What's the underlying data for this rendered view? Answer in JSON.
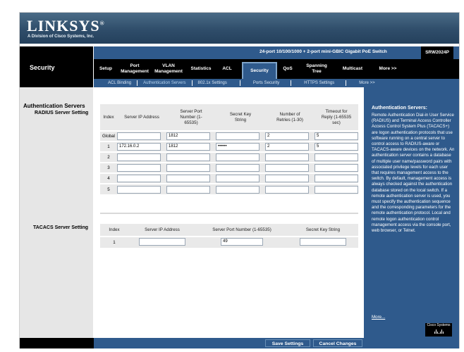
{
  "brand": {
    "logo": "LINKSYS",
    "tagline": "A Division of Cisco Systems, Inc."
  },
  "header": {
    "section": "Security",
    "model_desc": "24-port 10/100/1000 + 2-port mini-GBIC Gigabit PoE Switch",
    "model_num": "SRW2024P"
  },
  "tabs": [
    {
      "label": "Setup"
    },
    {
      "label": "Port Management"
    },
    {
      "label": "VLAN Management"
    },
    {
      "label": "Statistics"
    },
    {
      "label": "ACL"
    },
    {
      "label": "Security"
    },
    {
      "label": "QoS"
    },
    {
      "label": "Spanning Tree"
    },
    {
      "label": "Multicast"
    },
    {
      "label": "More >>"
    }
  ],
  "subtabs": [
    {
      "label": "ACL Binding"
    },
    {
      "label": "Authentication Servers"
    },
    {
      "label": "802.1x Settings"
    },
    {
      "label": "Ports Security"
    },
    {
      "label": "HTTPS Settings"
    },
    {
      "label": "More >>"
    }
  ],
  "sidebar": {
    "heading": "Authentication Servers",
    "radius_label": "RADIUS Server Setting",
    "tacacs_label": "TACACS Server Setting"
  },
  "radius": {
    "headers": {
      "index": "Index",
      "ip": "Server IP Address",
      "port": "Server Port Number (1-65535)",
      "key": "Secret Key String",
      "retries": "Number of Retries (1-30)",
      "timeout": "Timeout for Reply (1-65535 sec)"
    },
    "rows": [
      {
        "index": "Global",
        "ip": "",
        "port": "1812",
        "key": "",
        "retries": "2",
        "timeout": "5"
      },
      {
        "index": "1",
        "ip": "172.16.0.2",
        "port": "1812",
        "key": "••••••",
        "retries": "2",
        "timeout": "5"
      },
      {
        "index": "2",
        "ip": "",
        "port": "",
        "key": "",
        "retries": "",
        "timeout": ""
      },
      {
        "index": "3",
        "ip": "",
        "port": "",
        "key": "",
        "retries": "",
        "timeout": ""
      },
      {
        "index": "4",
        "ip": "",
        "port": "",
        "key": "",
        "retries": "",
        "timeout": ""
      },
      {
        "index": "5",
        "ip": "",
        "port": "",
        "key": "",
        "retries": "",
        "timeout": ""
      }
    ]
  },
  "tacacs": {
    "headers": {
      "index": "Index",
      "ip": "Server IP Address",
      "port": "Server Port Number (1-65535)",
      "key": "Secret Key String"
    },
    "rows": [
      {
        "index": "1",
        "ip": "",
        "port": "49",
        "key": ""
      }
    ]
  },
  "help": {
    "title": "Authentication Servers:",
    "body": "Remote Authentication Dial-in User Service (RADIUS) and Terminal Access Controller Access Control System Plus (TACACS+) are logon authentication protocols that use software running on a central server to control access to RADIUS-aware or TACACS-aware devices on the network. An authentication server contains a database of multiple user name/password pairs with associated privilege levels for each user that requires management access to the switch. By default, management access is always checked against the authentication database stored on the local switch. If a remote authentication server is used, you must specify the authentication sequence and the corresponding parameters for the remote authentication protocol. Local and remote logon authentication control management access via the console port, web browser, or Telnet.",
    "more": "More...",
    "cisco": "Cisco Systems"
  },
  "buttons": {
    "save": "Save Settings",
    "cancel": "Cancel Changes"
  },
  "colors": {
    "blue": "#2f5a8c",
    "black": "#000000",
    "panel_gray": "#e6e6e6"
  }
}
